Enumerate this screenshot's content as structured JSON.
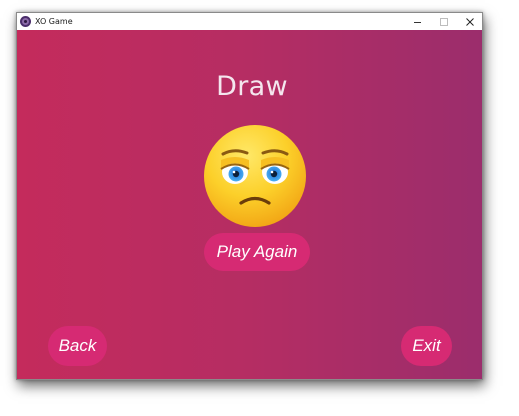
{
  "window": {
    "title": "XO Game",
    "icon": "app-icon",
    "controls": {
      "minimize": "minimize-icon",
      "maximize": "maximize-icon",
      "close": "close-icon"
    }
  },
  "game": {
    "result_text": "Draw",
    "result_emoji": "tired-face-emoji",
    "play_again_label": "Play Again",
    "back_label": "Back",
    "exit_label": "Exit"
  },
  "colors": {
    "background_left": "#c42b5c",
    "background_right": "#9b2d6c",
    "button": "#d62a73",
    "text": "#ffffff"
  }
}
